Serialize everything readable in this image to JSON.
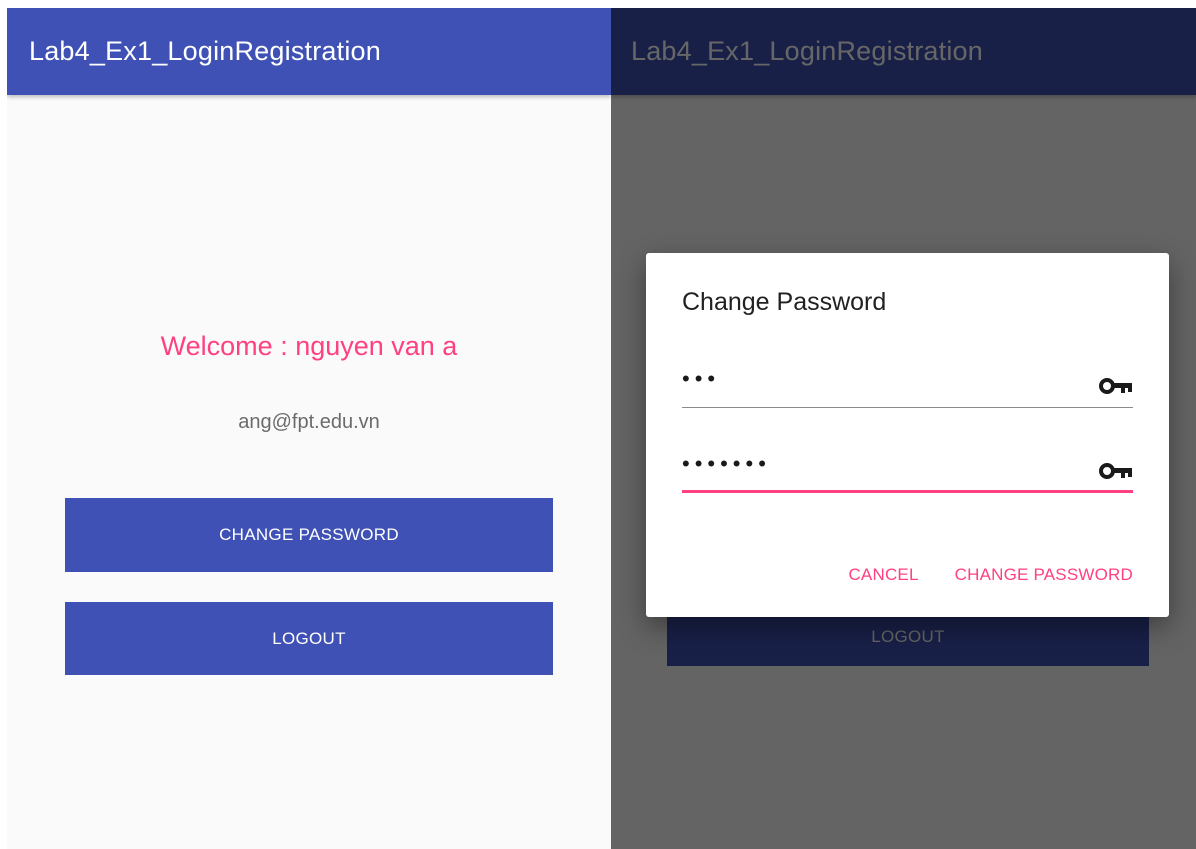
{
  "app": {
    "title": "Lab4_Ex1_LoginRegistration"
  },
  "profile": {
    "welcome": "Welcome : nguyen van a",
    "email": "ang@fpt.edu.vn"
  },
  "buttons": {
    "change_password": "CHANGE PASSWORD",
    "logout": "LOGOUT"
  },
  "dialog": {
    "title": "Change Password",
    "old_password_masked": "•••",
    "new_password_masked": "•••••••",
    "cancel_label": "CANCEL",
    "confirm_label": "CHANGE PASSWORD"
  },
  "colors": {
    "primary": "#3f51b5",
    "accent": "#ff4081",
    "scrim": "rgba(0,0,0,0.6)"
  },
  "icons": {
    "password_toggle": "key-icon"
  }
}
